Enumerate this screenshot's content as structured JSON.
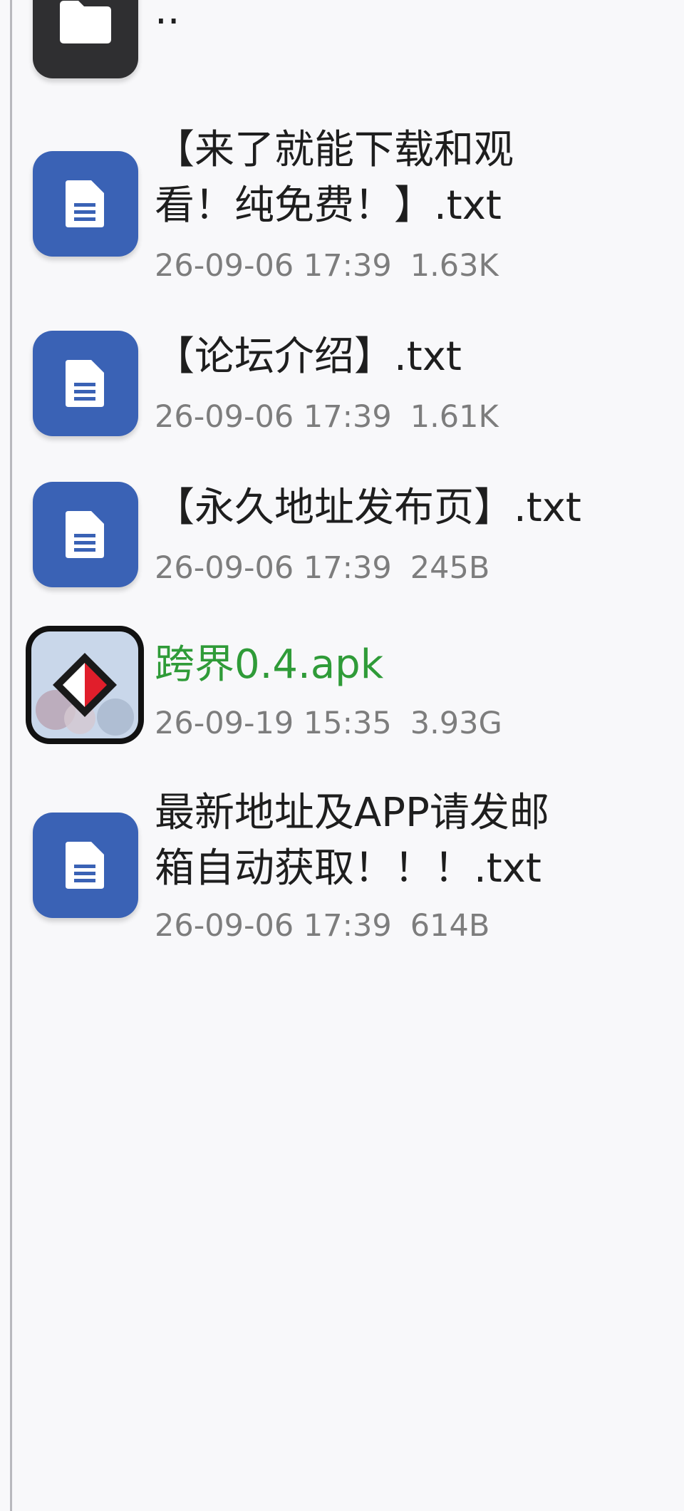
{
  "file_list": {
    "parent": {
      "name": "..",
      "icon": "folder-icon"
    },
    "items": [
      {
        "name_lines": [
          "【来了就能下载和观",
          "看！纯免费！】.txt"
        ],
        "date": "26-09-06 17:39",
        "size": "1.63K",
        "icon": "document-icon"
      },
      {
        "name_lines": [
          "【论坛介绍】.txt"
        ],
        "date": "26-09-06 17:39",
        "size": "1.61K",
        "icon": "document-icon"
      },
      {
        "name_lines": [
          "【永久地址发布页】.txt"
        ],
        "date": "26-09-06 17:39",
        "size": "245B",
        "icon": "document-icon"
      },
      {
        "name_lines": [
          "跨界0.4.apk"
        ],
        "date": "26-09-19 15:35",
        "size": "3.93G",
        "icon": "apk-app-icon",
        "name_color": "#2f9b38"
      },
      {
        "name_lines": [
          "最新地址及APP请发邮",
          "箱自动获取！！！.txt"
        ],
        "date": "26-09-06 17:39",
        "size": "614B",
        "icon": "document-icon"
      }
    ]
  },
  "colors": {
    "document_icon_bg": "#3a62b5",
    "folder_icon_bg": "#2f2f31",
    "apk_name": "#2f9b38",
    "meta_text": "#7d7d7d",
    "background": "#f8f8fa"
  }
}
